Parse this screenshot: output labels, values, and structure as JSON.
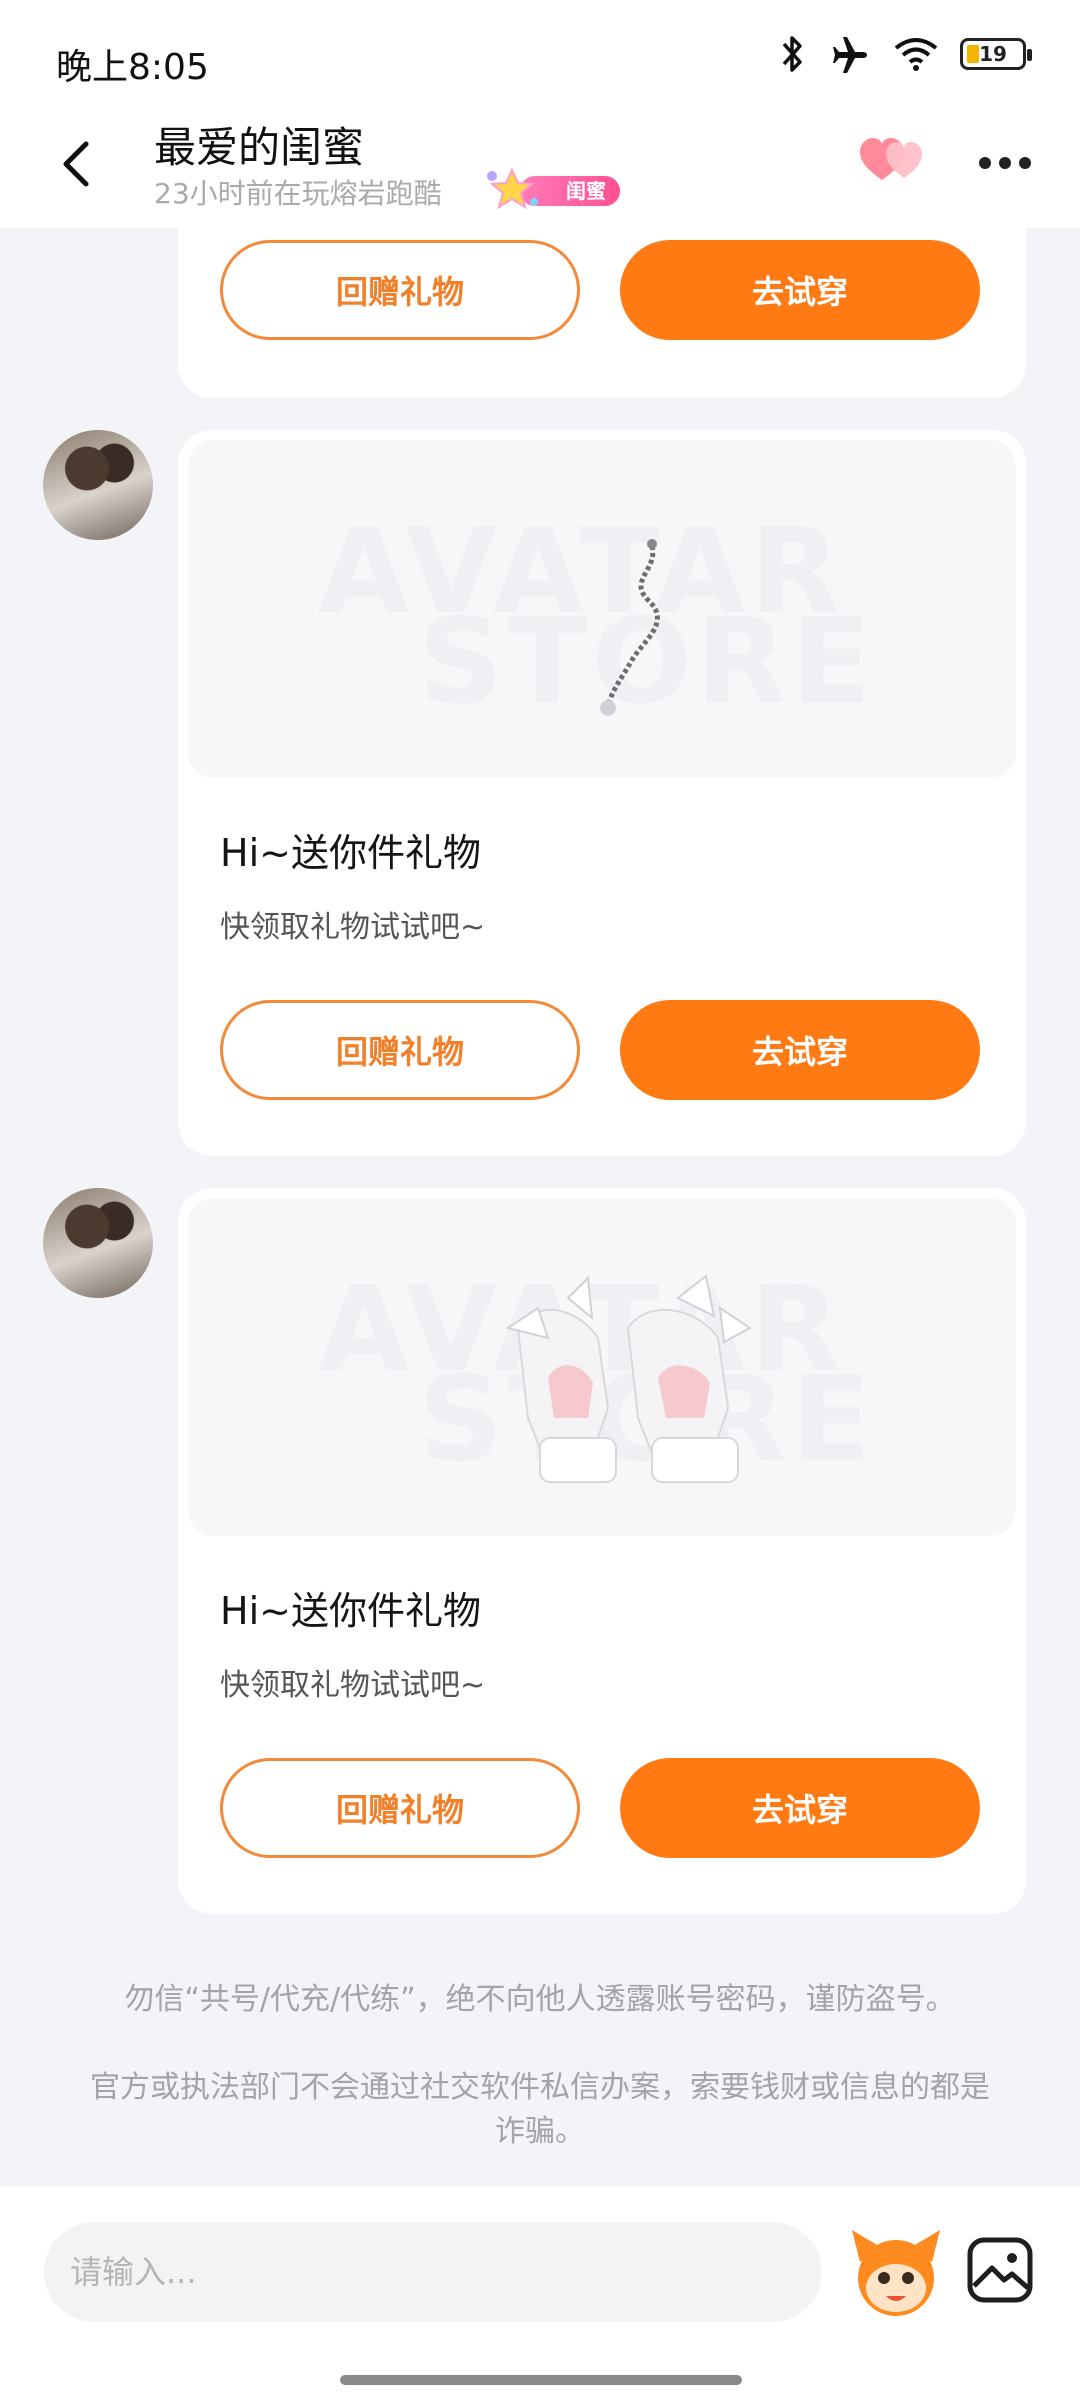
{
  "status_bar": {
    "time": "晚上8:05",
    "battery": "19"
  },
  "header": {
    "title": "最爱的闺蜜",
    "subtitle": "23小时前在玩熔岩跑酷",
    "badge": "闺蜜"
  },
  "cards": [
    {
      "watermark_1": "AVATAR",
      "watermark_2": "STORE",
      "title": "Hi~送你件礼物",
      "subtitle": "快领取礼物试试吧~",
      "return_label": "回赠礼物",
      "try_label": "去试穿"
    },
    {
      "watermark_1": "AVATAR",
      "watermark_2": "STORE",
      "title": "Hi~送你件礼物",
      "subtitle": "快领取礼物试试吧~",
      "return_label": "回赠礼物",
      "try_label": "去试穿"
    }
  ],
  "top_card": {
    "return_label": "回赠礼物",
    "try_label": "去试穿"
  },
  "notices": {
    "line1": "勿信“共号/代充/代练”，绝不向他人透露账号密码，谨防盗号。",
    "line2": "官方或执法部门不会通过社交软件私信办案，索要钱财或信息的都是诈骗。"
  },
  "input": {
    "placeholder": "请输入..."
  },
  "colors": {
    "accent": "#ff7a12",
    "badge": "#ff4f93"
  },
  "icons": [
    "back-icon",
    "hearts-icon",
    "more-icon",
    "emoji-icon",
    "gallery-icon",
    "bluetooth-icon",
    "airplane-icon",
    "wifi-icon"
  ]
}
